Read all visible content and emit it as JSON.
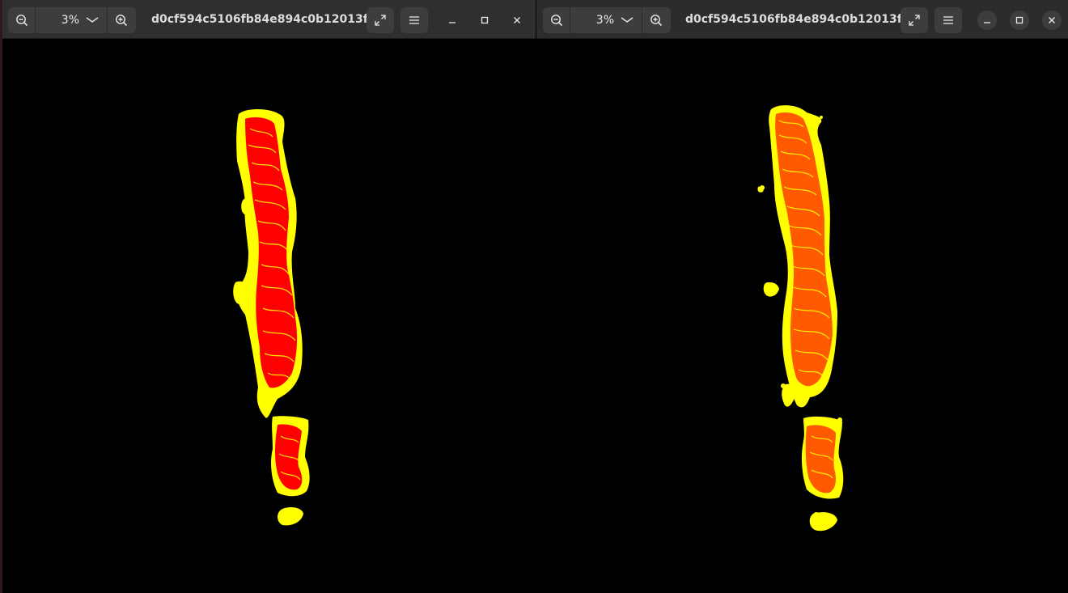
{
  "colors": {
    "headerbar": "#2f2f2f",
    "button": "#3d3d3d",
    "canvas": "#000000",
    "tissue_outer": "#ffff00",
    "tissue_inner": "#ff0000",
    "tissue_inner_alt": "#ff5a00"
  },
  "viewers": [
    {
      "zoom_value": "3%",
      "filename": "d0cf594c5106fb84e894c0b12013f...",
      "icons": [
        "zoom-out-icon",
        "chevron-down-icon",
        "zoom-in-icon",
        "fullscreen-icon",
        "menu-icon",
        "minimize-icon",
        "maximize-icon",
        "close-icon"
      ]
    },
    {
      "zoom_value": "3%",
      "filename": "d0cf594c5106fb84e894c0b12013f...",
      "icons": [
        "zoom-out-icon",
        "chevron-down-icon",
        "zoom-in-icon",
        "fullscreen-icon",
        "menu-icon",
        "minimize-icon",
        "maximize-icon",
        "close-icon"
      ]
    }
  ]
}
